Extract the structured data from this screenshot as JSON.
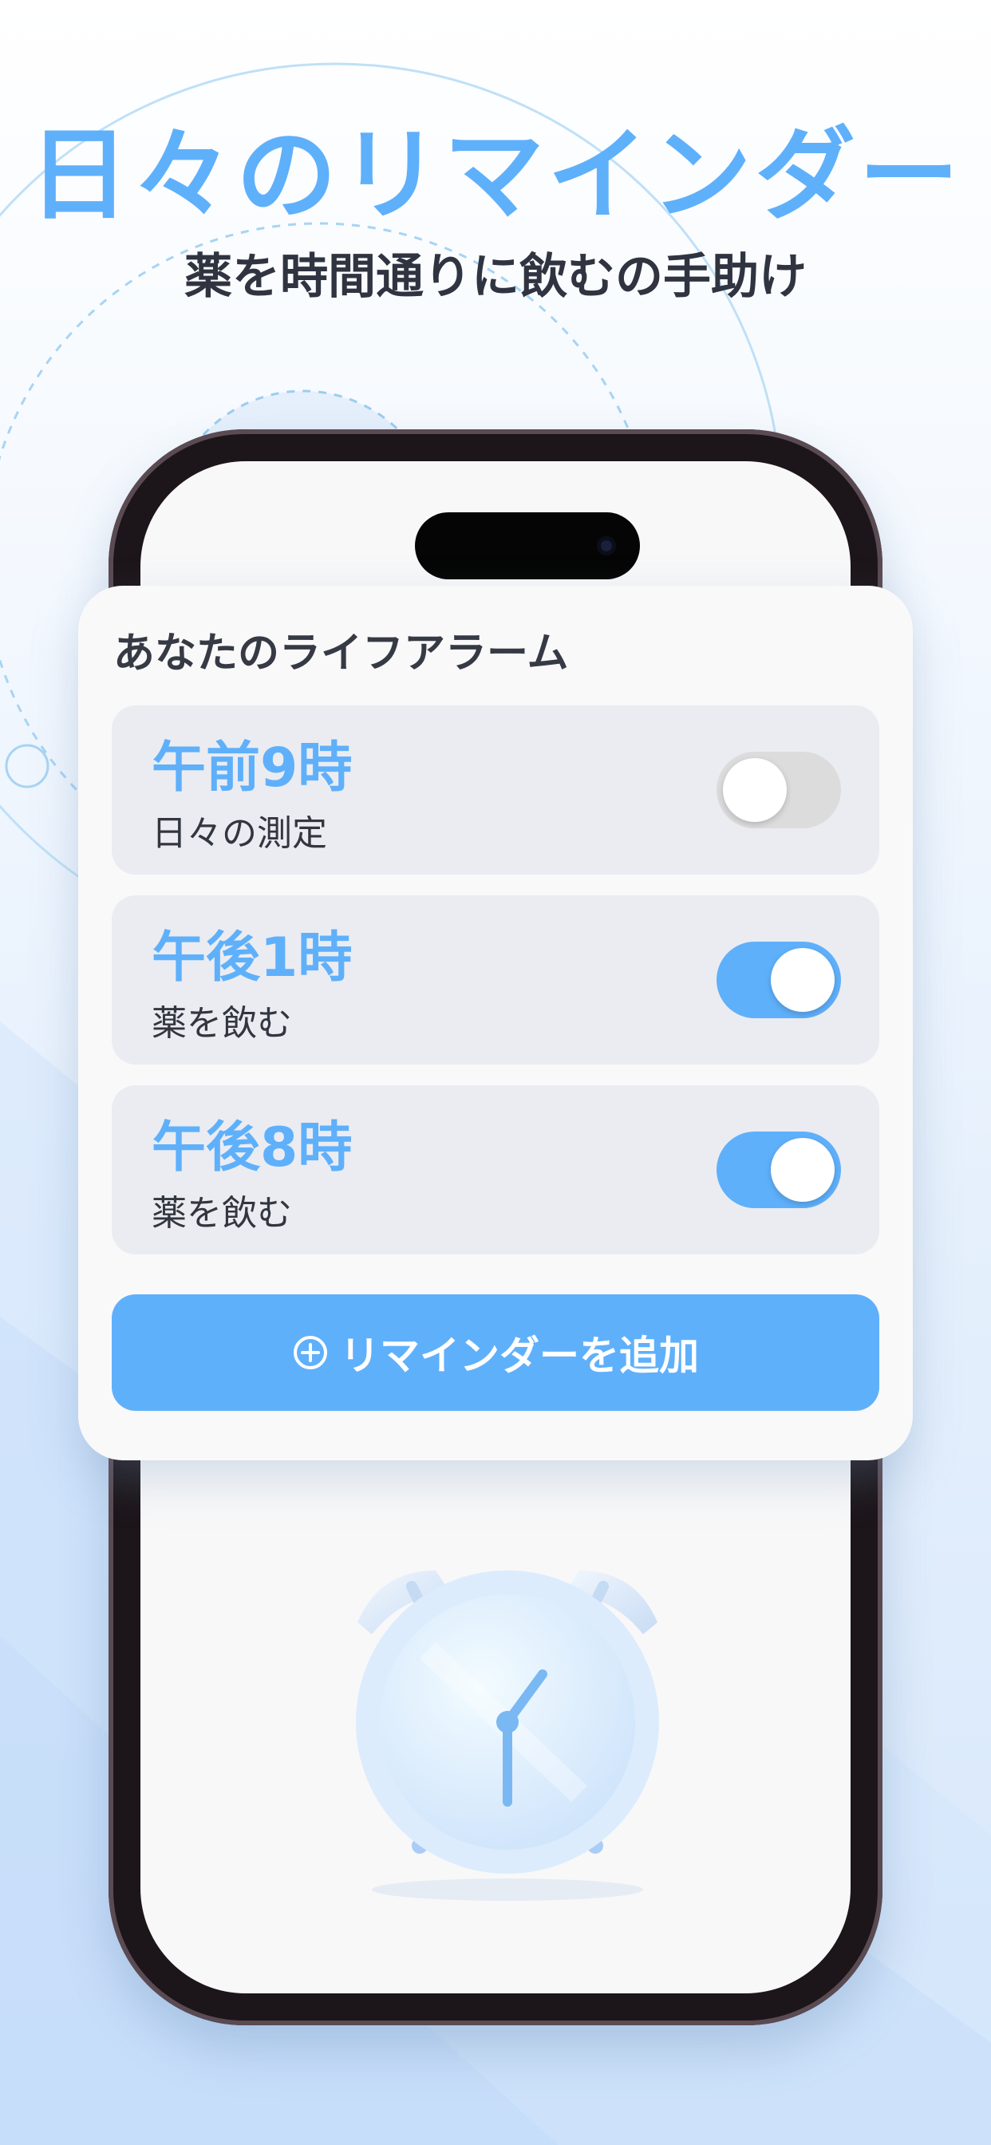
{
  "promo": {
    "headline": "日々のリマインダー",
    "subheadline": "薬を時間通りに飲むの手助け"
  },
  "card": {
    "title": "あなたのライフアラーム",
    "alarms": [
      {
        "time": "午前9時",
        "label": "日々の測定",
        "enabled": false
      },
      {
        "time": "午後1時",
        "label": "薬を飲む",
        "enabled": true
      },
      {
        "time": "午後8時",
        "label": "薬を飲む",
        "enabled": true
      }
    ],
    "add_button_label": "リマインダーを追加"
  },
  "icons": {
    "add": "plus-circle-icon",
    "illustration": "alarm-clock-icon"
  },
  "colors": {
    "accent": "#5fb0fb",
    "toggle_off": "#dcdcdd",
    "row_background": "#ebecf1",
    "phone_frame": "#1c1519"
  }
}
